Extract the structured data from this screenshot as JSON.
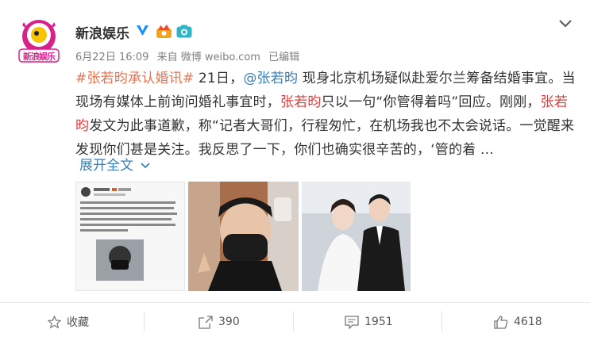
{
  "post": {
    "author": "新浪娱乐",
    "timestamp": "6月22日 16:09",
    "source": "来自 微博 weibo.com",
    "edited": "已编辑",
    "content": {
      "hashtag": "#张若昀承认婚讯#",
      "t1": " 21日，",
      "mention": "@张若昀",
      "t2": " 现身北京机场疑似赴爱尔兰筹备结婚事宜。当现场有媒体上前询问婚礼事宜时，",
      "name1": "张若昀",
      "t3": "只以一句“你管得着吗”回应。刚刚，",
      "name2": "张若昀",
      "t4": "发文为此事道歉，称“记者大哥们，行程匆忙，在机场我也不太会说话。一觉醒来发现你们甚是关注。我反思了一下，你们也确实很辛苦的，‘管的着 ..."
    },
    "expand_label": "展开全文",
    "avatar_text": "新浪娱乐"
  },
  "actions": {
    "favorite": "收藏",
    "repost": "390",
    "comment": "1951",
    "like": "4618"
  },
  "colors": {
    "hashtag": "#eb7350",
    "link": "#3a7fb8",
    "highlight_red": "#e03c3c",
    "verified_blue": "#1f8ff3"
  }
}
